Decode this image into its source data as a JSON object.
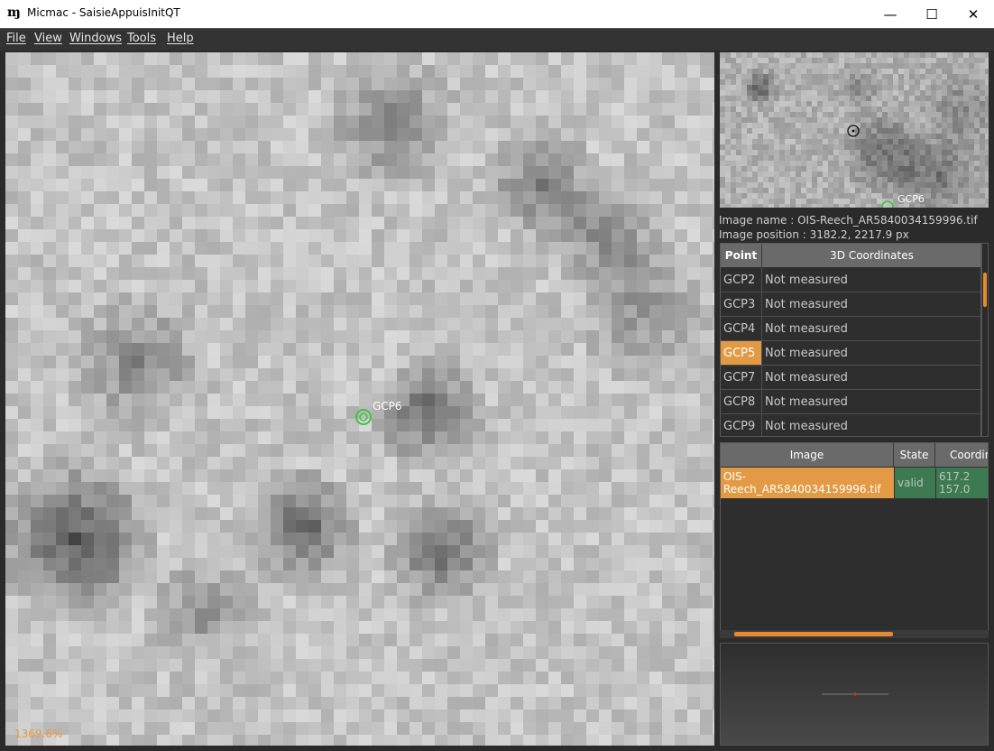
{
  "window": {
    "title": "Micmac - SaisieAppuisInitQT",
    "app_icon_glyph": "ɱ",
    "controls": {
      "minimize": "—",
      "maximize": "☐",
      "close": "✕"
    }
  },
  "menu": [
    "File",
    "View",
    "Windows",
    "Tools",
    "Help"
  ],
  "viewer": {
    "zoom": "1369.6%",
    "marker_label": "GCP6",
    "marker_color": "#3ec43e"
  },
  "preview": {
    "marker_label": "GCP6",
    "icon": "target-icon"
  },
  "image_info": {
    "name_line": "Image name : OIS-Reech_AR5840034159996.tif",
    "position_line": "Image position : 3182.2, 2217.9 px"
  },
  "points_table": {
    "headers": [
      "Point",
      "3D Coordinates"
    ],
    "rows": [
      {
        "point": "GCP2",
        "coords": "Not measured"
      },
      {
        "point": "GCP3",
        "coords": "Not measured"
      },
      {
        "point": "GCP4",
        "coords": "Not measured"
      },
      {
        "point": "GCP5",
        "coords": "Not measured",
        "selected": true
      },
      {
        "point": "GCP7",
        "coords": "Not measured"
      },
      {
        "point": "GCP8",
        "coords": "Not measured"
      },
      {
        "point": "GCP9",
        "coords": "Not measured"
      }
    ]
  },
  "images_table": {
    "headers": [
      "Image",
      "State",
      "Coordin"
    ],
    "rows": [
      {
        "image": "OIS-Reech_AR5840034159996.tif",
        "state": "valid",
        "coord_x": "617.2",
        "coord_y": "157.0"
      }
    ]
  },
  "colors": {
    "accent": "#e68a2e",
    "valid_green": "#3d7a52",
    "selected_orange": "#e39a45"
  }
}
